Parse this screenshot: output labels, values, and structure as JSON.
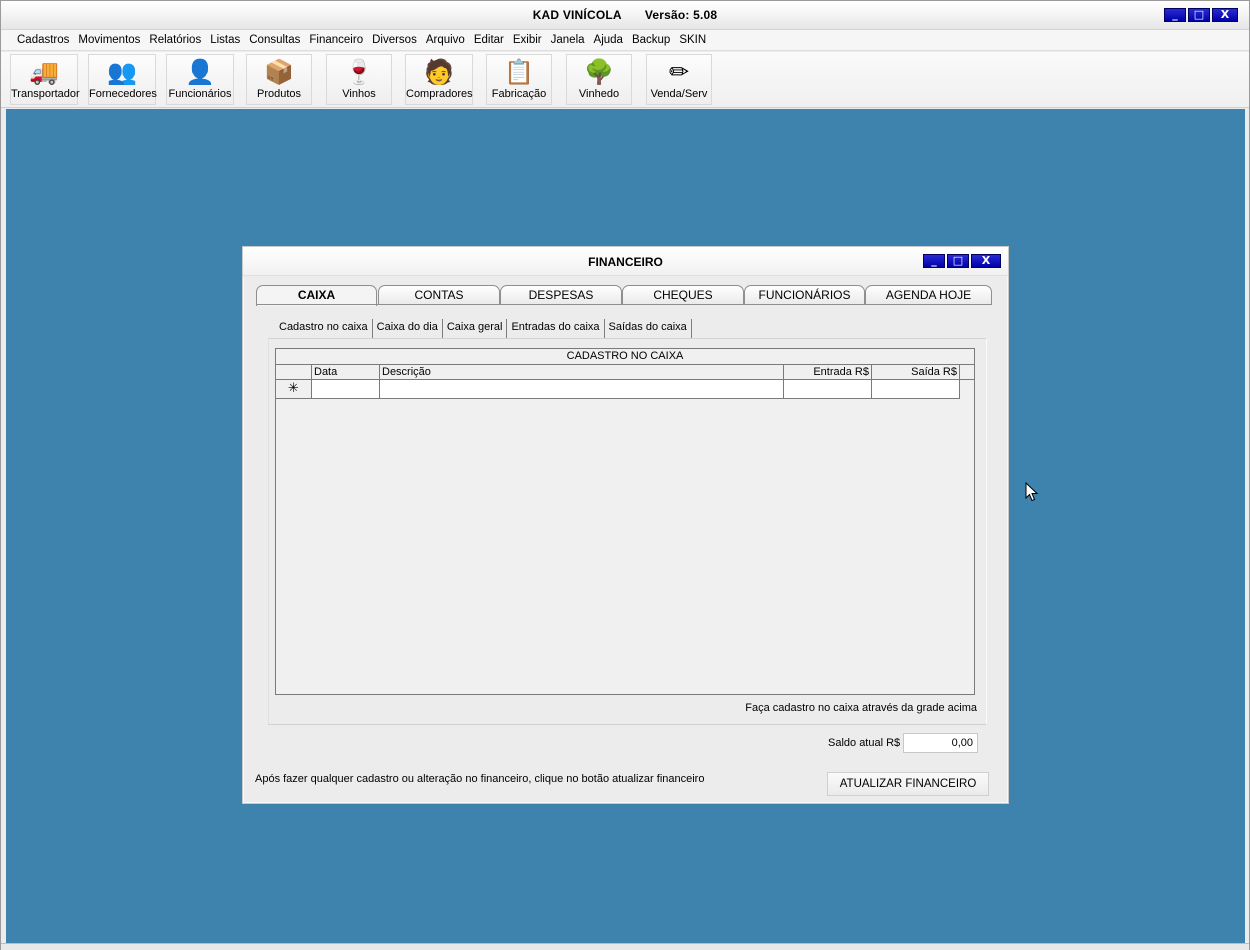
{
  "app": {
    "title": "KAD VINÍCOLA",
    "version": "Versão: 5.08",
    "window_buttons": [
      "_",
      "□",
      "X"
    ]
  },
  "menu": [
    "Cadastros",
    "Movimentos",
    "Relatórios",
    "Listas",
    "Consultas",
    "Financeiro",
    "Diversos",
    "Arquivo",
    "Editar",
    "Exibir",
    "Janela",
    "Ajuda",
    "Backup",
    "SKIN"
  ],
  "toolbar": [
    {
      "label": "Transportador",
      "icon": "truck-icon",
      "glyph": "🚚"
    },
    {
      "label": "Fornecedores",
      "icon": "suppliers-icon",
      "glyph": "👥"
    },
    {
      "label": "Funcionários",
      "icon": "employee-icon",
      "glyph": "👤"
    },
    {
      "label": "Produtos",
      "icon": "box-icon",
      "glyph": "📦"
    },
    {
      "label": "Vinhos",
      "icon": "wine-glass-icon",
      "glyph": "🍷"
    },
    {
      "label": "Compradores",
      "icon": "buyer-icon",
      "glyph": "🧑"
    },
    {
      "label": "Fabricação",
      "icon": "clipboard-icon",
      "glyph": "📋"
    },
    {
      "label": "Vinhedo",
      "icon": "tree-icon",
      "glyph": "🌳"
    },
    {
      "label": "Venda/Serv",
      "icon": "pencil-icon",
      "glyph": "✏"
    }
  ],
  "dialog": {
    "title": "FINANCEIRO",
    "window_buttons": [
      "_",
      "□",
      "X"
    ],
    "tabs": [
      "CAIXA",
      "CONTAS",
      "DESPESAS",
      "CHEQUES",
      "FUNCIONÁRIOS",
      "AGENDA HOJE"
    ],
    "active_tab": "CAIXA",
    "subtabs": [
      "Cadastro no caixa",
      "Caixa do dia",
      "Caixa geral",
      "Entradas do caixa",
      "Saídas do caixa"
    ],
    "active_subtab": "Cadastro no caixa",
    "grid": {
      "caption": "CADASTRO NO CAIXA",
      "columns": [
        "Data",
        "Descrição",
        "Entrada R$",
        "Saída R$"
      ],
      "new_row_marker": "✳"
    },
    "hint": "Faça cadastro no caixa através da grade acima",
    "saldo_label": "Saldo atual R$",
    "saldo_value": "0,00",
    "footer_note": "Após fazer qualquer cadastro ou alteração no financeiro, clique no botão atualizar financeiro",
    "update_button": "ATUALIZAR FINANCEIRO"
  },
  "colors": {
    "desktop": "#3e82ae",
    "title_buttons": "#0000a8"
  }
}
